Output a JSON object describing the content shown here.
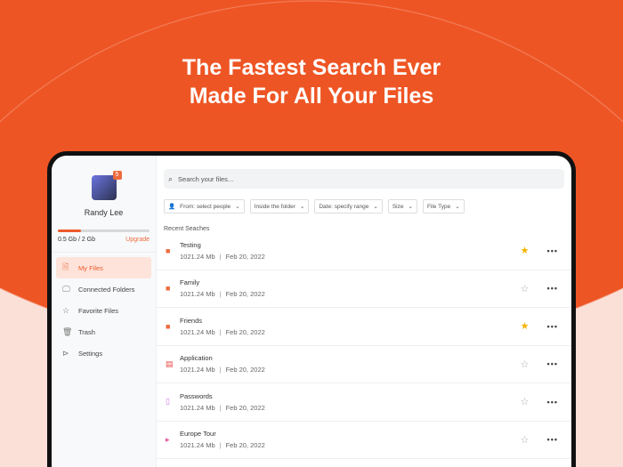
{
  "hero": {
    "line1": "The Fastest Search Ever",
    "line2": "Made For All Your Files"
  },
  "user": {
    "name": "Randy Lee",
    "badge": "5",
    "usage": "0.5 Gb / 2 Gb",
    "usage_fraction": 0.25,
    "upgrade": "Upgrade"
  },
  "nav": [
    {
      "label": "My Files",
      "icon": "file-icon",
      "active": true
    },
    {
      "label": "Connected Folders",
      "icon": "monitor-icon"
    },
    {
      "label": "Favorite Files",
      "icon": "star-icon"
    },
    {
      "label": "Trash",
      "icon": "trash-icon"
    },
    {
      "label": "Settings",
      "icon": "play-circle-icon"
    }
  ],
  "search": {
    "placeholder": "Search your files..."
  },
  "filters": [
    "From: select people",
    "Inside the folder",
    "Date: specify range",
    "Size",
    "File Type"
  ],
  "recent_label": "Recent Seaches",
  "files": [
    {
      "name": "Testing",
      "size": "1021.24 Mb",
      "date": "Feb 20, 2022",
      "icon": "folder-icon",
      "starred": true,
      "color": "#ee6a3d"
    },
    {
      "name": "Family",
      "size": "1021.24 Mb",
      "date": "Feb 20, 2022",
      "icon": "folder-icon",
      "starred": false,
      "color": "#ee6a3d"
    },
    {
      "name": "Friends",
      "size": "1021.24 Mb",
      "date": "Feb 20, 2022",
      "icon": "folder-icon",
      "starred": true,
      "color": "#ee6a3d"
    },
    {
      "name": "Application",
      "size": "1021.24 Mb",
      "date": "Feb 20, 2022",
      "icon": "pdf-icon",
      "starred": false,
      "color": "#e84545"
    },
    {
      "name": "Passwords",
      "size": "1021.24 Mb",
      "date": "Feb 20, 2022",
      "icon": "document-icon",
      "starred": false,
      "color": "#c77ddb"
    },
    {
      "name": "Europe Tour",
      "size": "1021.24 Mb",
      "date": "Feb 20, 2022",
      "icon": "video-file-icon",
      "starred": false,
      "color": "#e85a9a"
    }
  ]
}
